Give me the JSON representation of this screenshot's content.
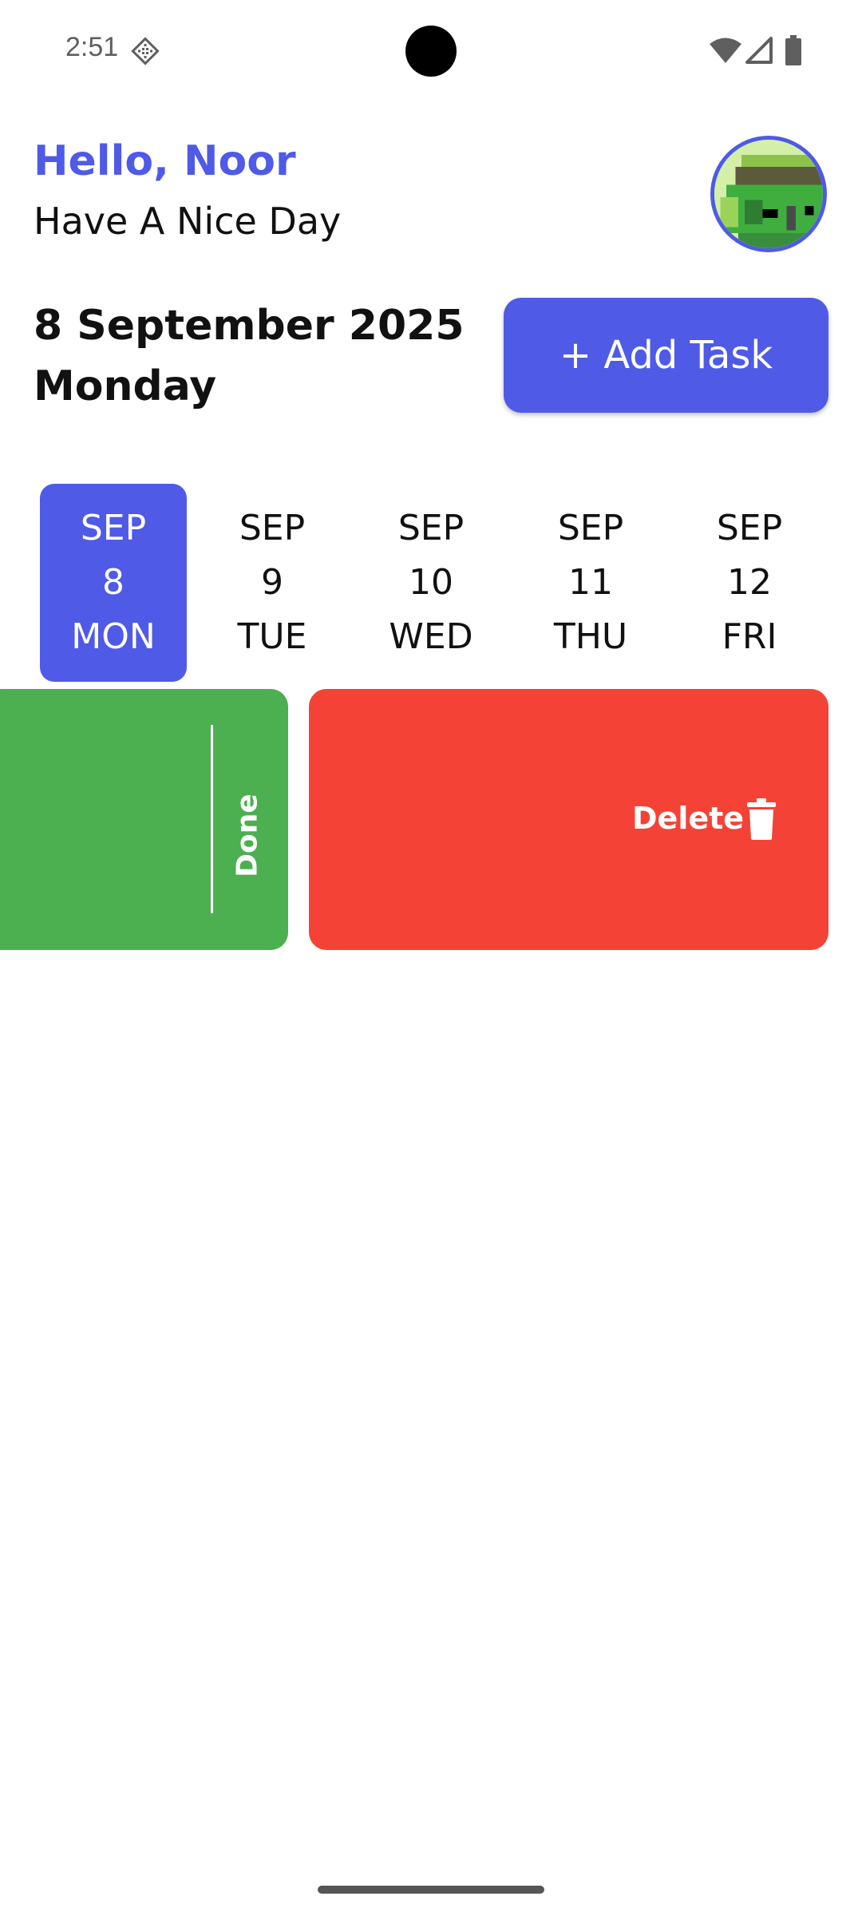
{
  "status_bar": {
    "time": "2:51"
  },
  "header": {
    "greeting": "Hello, Noor",
    "subtitle": "Have A Nice Day"
  },
  "date_section": {
    "date": "8 September 2025",
    "weekday": "Monday",
    "add_task_label": "+ Add Task"
  },
  "date_strip": [
    {
      "month": "SEP",
      "day": "8",
      "weekday": "MON",
      "selected": true
    },
    {
      "month": "SEP",
      "day": "9",
      "weekday": "TUE",
      "selected": false
    },
    {
      "month": "SEP",
      "day": "10",
      "weekday": "WED",
      "selected": false
    },
    {
      "month": "SEP",
      "day": "11",
      "weekday": "THU",
      "selected": false
    },
    {
      "month": "SEP",
      "day": "12",
      "weekday": "FRI",
      "selected": false
    }
  ],
  "task_card": {
    "done_label": "Done",
    "delete_label": "Delete"
  },
  "colors": {
    "accent": "#4f5ae6",
    "done": "#4caf50",
    "delete": "#f44336"
  },
  "icons": [
    "notification-icon",
    "wifi-icon",
    "signal-icon",
    "battery-icon",
    "avatar",
    "trash-icon"
  ]
}
